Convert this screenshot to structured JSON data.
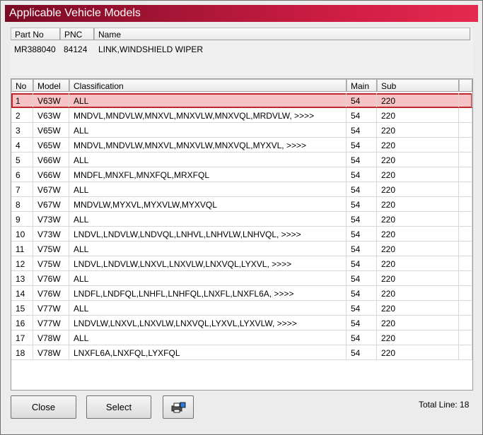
{
  "window": {
    "title": "Applicable Vehicle Models"
  },
  "part_header": {
    "columns": [
      "Part No",
      "PNC",
      "Name"
    ],
    "values": [
      "MR388040",
      "84124",
      "LINK,WINDSHIELD WIPER"
    ]
  },
  "table": {
    "columns": [
      "No",
      "Model",
      "Classification",
      "Main",
      "Sub"
    ],
    "rows": [
      [
        "1",
        "V63W",
        "ALL",
        "54",
        "220"
      ],
      [
        "2",
        "V63W",
        "MNDVL,MNDVLW,MNXVL,MNXVLW,MNXVQL,MRDVLW,  >>>>",
        "54",
        "220"
      ],
      [
        "3",
        "V65W",
        "ALL",
        "54",
        "220"
      ],
      [
        "4",
        "V65W",
        "MNDVL,MNDVLW,MNXVL,MNXVLW,MNXVQL,MYXVL,  >>>>",
        "54",
        "220"
      ],
      [
        "5",
        "V66W",
        "ALL",
        "54",
        "220"
      ],
      [
        "6",
        "V66W",
        "MNDFL,MNXFL,MNXFQL,MRXFQL",
        "54",
        "220"
      ],
      [
        "7",
        "V67W",
        "ALL",
        "54",
        "220"
      ],
      [
        "8",
        "V67W",
        "MNDVLW,MYXVL,MYXVLW,MYXVQL",
        "54",
        "220"
      ],
      [
        "9",
        "V73W",
        "ALL",
        "54",
        "220"
      ],
      [
        "10",
        "V73W",
        "LNDVL,LNDVLW,LNDVQL,LNHVL,LNHVLW,LNHVQL,  >>>>",
        "54",
        "220"
      ],
      [
        "11",
        "V75W",
        "ALL",
        "54",
        "220"
      ],
      [
        "12",
        "V75W",
        "LNDVL,LNDVLW,LNXVL,LNXVLW,LNXVQL,LYXVL,  >>>>",
        "54",
        "220"
      ],
      [
        "13",
        "V76W",
        "ALL",
        "54",
        "220"
      ],
      [
        "14",
        "V76W",
        "LNDFL,LNDFQL,LNHFL,LNHFQL,LNXFL,LNXFL6A,  >>>>",
        "54",
        "220"
      ],
      [
        "15",
        "V77W",
        "ALL",
        "54",
        "220"
      ],
      [
        "16",
        "V77W",
        "LNDVLW,LNXVL,LNXVLW,LNXVQL,LYXVL,LYXVLW,  >>>>",
        "54",
        "220"
      ],
      [
        "17",
        "V78W",
        "ALL",
        "54",
        "220"
      ],
      [
        "18",
        "V78W",
        "LNXFL6A,LNXFQL,LYXFQL",
        "54",
        "220"
      ]
    ],
    "selected_row": 0
  },
  "buttons": {
    "close": "Close",
    "select": "Select",
    "print_icon": "printer-icon"
  },
  "footer": {
    "total_label": "Total Line: 18"
  },
  "colors": {
    "title_start": "#7a0a24",
    "title_end": "#e52a4f",
    "selected_bg": "#f7c2c4",
    "selected_border": "#c0262a"
  }
}
